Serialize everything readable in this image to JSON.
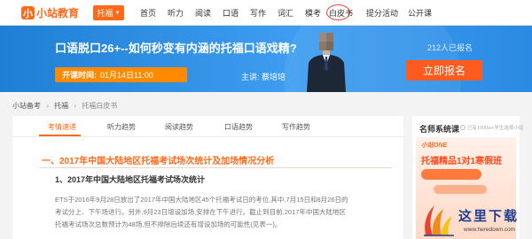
{
  "nav": {
    "logo_text": "小站教育",
    "category": "托福",
    "items": [
      "首页",
      "听力",
      "阅读",
      "口语",
      "写作",
      "词汇",
      "模考",
      "白皮书",
      "提分活动",
      "公开课"
    ],
    "highlighted": "白皮书"
  },
  "banner": {
    "title": "口语脱口26+--如何秒变有内涵的托福口语戏精?",
    "time_label": "开课时间:",
    "time_value": "01月14日11:00",
    "host": "主讲: 蔡培培",
    "count": "212人已报名",
    "button": "立即报名"
  },
  "breadcrumb": [
    "小站备考",
    "托福",
    "托福白皮书"
  ],
  "tabs": {
    "items": [
      "考情速递",
      "听力趋势",
      "阅读趋势",
      "口语趋势",
      "写作趋势"
    ],
    "active": "考情速递"
  },
  "article": {
    "heading": "一、2017年中国大陆地区托福考试场次统计及加场情况分析",
    "subheading": "1、2017年中国大陆地区托福考试场次统计",
    "paragraph_lines": [
      "ETS于2016年9月28日放出了2017年中国大陆地区45个托福考试日的考位,其中,7月15日和8月26日的",
      "考试分上、下午场进行。另外,9月23日增设加场,安排在下午进行。截止到目前,2017年中国大陆地区",
      "托福考试场次总数预计为48场,但不排除后续还有增设加场的可能性(见表一)。"
    ]
  },
  "sidebar": {
    "heading": "名师系统课",
    "note": "已有1000w+学生选择小站",
    "promo_brand": "小站ONE",
    "promo_title": "托福精品1对1寒假班"
  },
  "watermark": {
    "title": "这里下载",
    "url": "www.heredown.com"
  },
  "colors": {
    "accent": "#ff6a1a",
    "banner_blue": "#2b8ae3",
    "signup": "#ff5b1e"
  }
}
